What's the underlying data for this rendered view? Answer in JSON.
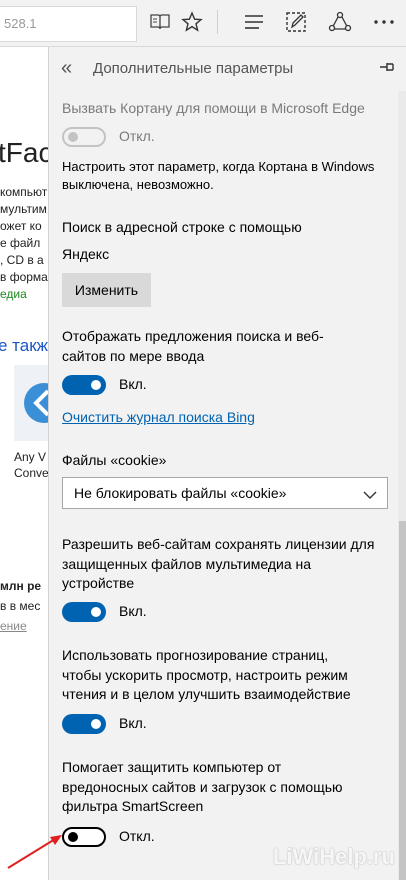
{
  "toolbar": {
    "address_fragment": "528.1",
    "icons": [
      "reading-view-icon",
      "favorite-star-icon",
      "hub-icon",
      "web-note-icon",
      "share-icon",
      "more-icon"
    ]
  },
  "background_page": {
    "title_fragment": "tFac",
    "lines": [
      "компьют",
      "мультим",
      "ожет ко",
      "е файл",
      ", CD в а",
      "в форма"
    ],
    "green_text": "едиа",
    "link_heading": "е такж",
    "caption_1": "Any V",
    "caption_2": "Conve",
    "bold_text": "млн ре",
    "line_mes": "в в мес",
    "link_small": "ение"
  },
  "panel": {
    "back_glyph": "«",
    "title": "Дополнительные параметры",
    "cortana": {
      "heading": "Вызвать Кортану для помощи в Microsoft Edge",
      "state": "Откл.",
      "note_line1": "Настроить этот параметр, когда Кортана в Windows",
      "note_line2": "выключена, невозможно."
    },
    "search": {
      "label": "Поиск в адресной строке с помощью",
      "engine": "Яндекс",
      "change_button": "Изменить"
    },
    "suggestions": {
      "line1": "Отображать предложения поиска и веб-",
      "line2": "сайтов по мере ввода",
      "state": "Вкл.",
      "clear_link": "Очистить журнал поиска Bing"
    },
    "cookies": {
      "label": "Файлы «cookie»",
      "selected": "Не блокировать файлы «cookie»"
    },
    "licenses": {
      "line1": "Разрешить веб-сайтам сохранять лицензии для",
      "line2": "защищенных файлов мультимедиа на",
      "line3": "устройстве",
      "state": "Вкл."
    },
    "prediction": {
      "line1": "Использовать прогнозирование страниц,",
      "line2": "чтобы ускорить просмотр, настроить режим",
      "line3": "чтения и в целом улучшить взаимодействие",
      "state": "Вкл."
    },
    "smartscreen": {
      "line1": "Помогает защитить компьютер от",
      "line2": "вредоносных сайтов и загрузок с помощью",
      "line3": "фильтра SmartScreen",
      "state": "Откл."
    }
  },
  "watermark": "LiWiHelp.ru",
  "colors": {
    "accent": "#0063b1",
    "annotation_arrow": "#e02020",
    "panel_bg": "#f2f2f2"
  }
}
